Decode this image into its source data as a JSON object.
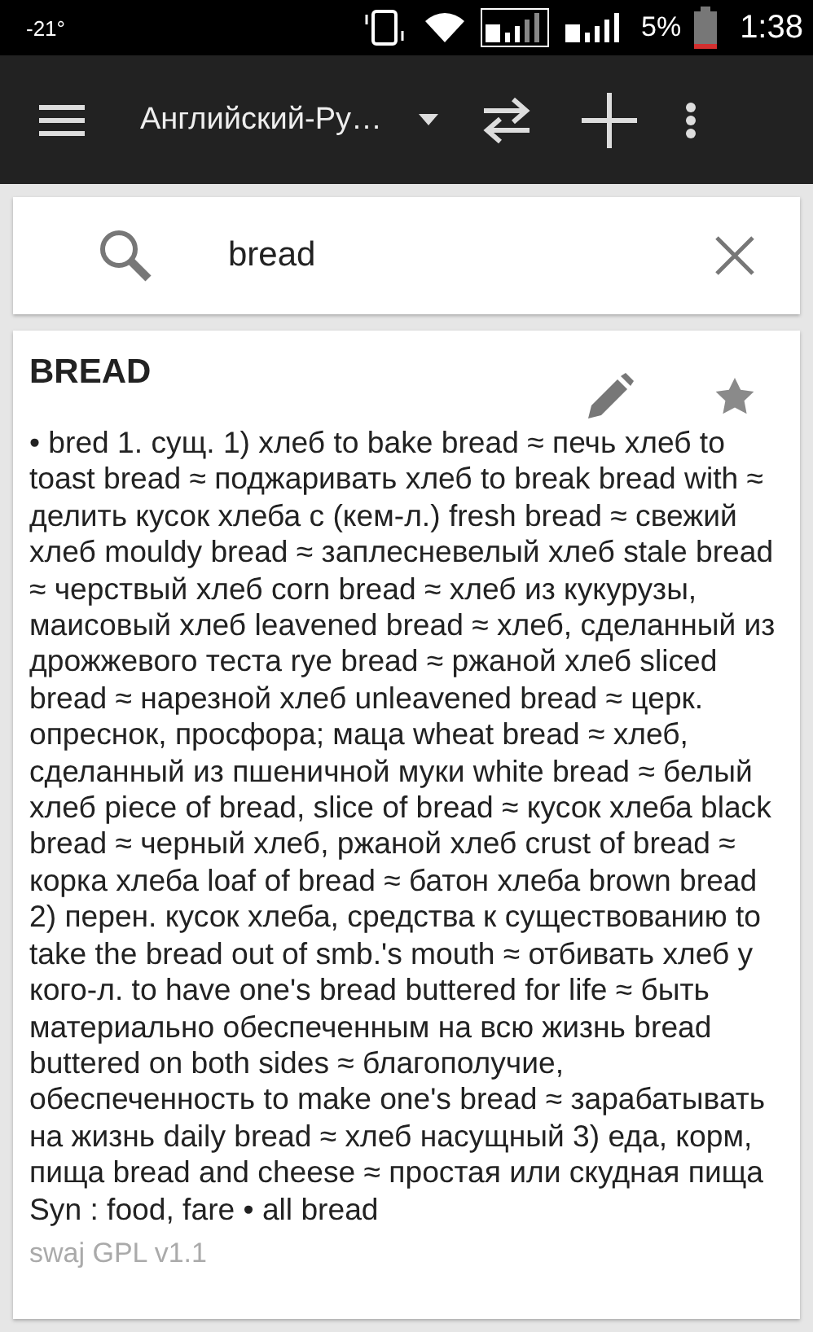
{
  "status_bar": {
    "temperature": "-21°",
    "battery": "5%",
    "time": "1:38"
  },
  "toolbar": {
    "dictionary": "Английский-Ру…"
  },
  "search": {
    "value": "bread"
  },
  "entry": {
    "headword": "BREAD",
    "starred": false,
    "definition": "• bred 1. сущ. 1) хлеб to bake bread ≈ печь хлеб to toast bread ≈ поджаривать хлеб to break bread with ≈ делить кусок хлеба с (кем-л.) fresh bread ≈ свежий хлеб mouldy bread ≈ заплесневелый хлеб stale bread ≈ черствый хлеб corn bread ≈ хлеб из кукурузы, маисовый хлеб leavened bread ≈ хлеб, сделанный из дрожжевого теста rye bread ≈ ржаной хлеб sliced bread ≈ нарезной хлеб unleavened bread ≈ церк. опреснок, просфора; маца wheat bread ≈ хлеб, сделанный из пшеничной муки white bread ≈ белый хлеб piece of bread, slice of bread ≈ кусок хлеба black bread ≈ черный хлеб, ржаной хлеб crust of bread ≈ корка хлеба loaf of bread ≈ батон хлеба brown bread 2) перен. кусок хлеба, средства к существованию to take the bread out of smb.'s mouth ≈ отбивать хлеб у кого-л. to have one's bread buttered for life ≈ быть материально обеспеченным на всю жизнь bread buttered on both sides ≈ благополучие, обеспеченность to make one's bread ≈ зарабатывать на жизнь daily bread ≈ хлеб насущный 3) еда, корм, пища bread and cheese ≈ простая или скудная пища Syn : food, fare • all bread"
  },
  "footer": "swaj GPL v1.1"
}
